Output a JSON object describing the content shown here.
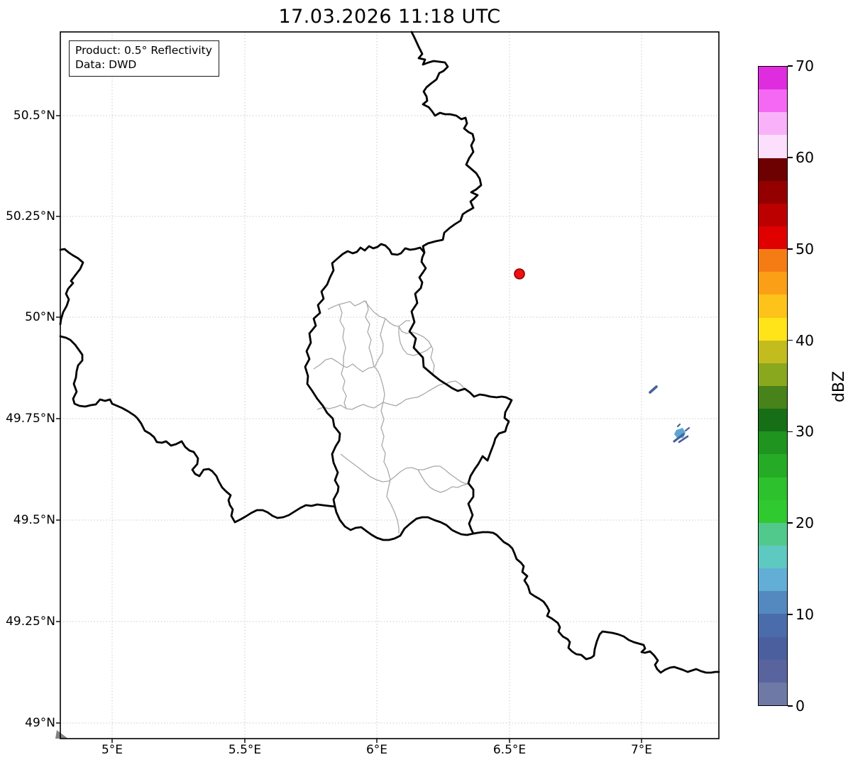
{
  "title": "17.03.2026 11:18 UTC",
  "info_box": {
    "product_line": "Product: 0.5° Reflectivity",
    "data_line": "Data: DWD"
  },
  "axes": {
    "x_ticks": [
      "5°E",
      "5.5°E",
      "6°E",
      "6.5°E",
      "7°E"
    ],
    "y_ticks": [
      "50.5°N",
      "50.25°N",
      "50°N",
      "49.75°N",
      "49.5°N",
      "49.25°N",
      "49°N"
    ]
  },
  "colorbar": {
    "label": "dBZ",
    "tick_values": [
      0,
      10,
      20,
      30,
      40,
      50,
      60,
      70
    ],
    "value_min": 0,
    "value_max": 70,
    "segment_step_dbz": 2.5,
    "segments_bottom_to_top": [
      "#6e79a5",
      "#59649f",
      "#4b5f9f",
      "#4a6cab",
      "#5389bf",
      "#62aed6",
      "#5ec9c0",
      "#52c98c",
      "#30c930",
      "#2dc22d",
      "#26ab26",
      "#1f941f",
      "#166f16",
      "#47821b",
      "#8aa81e",
      "#c3bc1e",
      "#ffe419",
      "#fdc31a",
      "#fb9f16",
      "#f57c14",
      "#e00000",
      "#bc0000",
      "#940000",
      "#6d0000",
      "#fcdffc",
      "#f9b2f9",
      "#f468f4",
      "#df2cdf"
    ]
  },
  "map": {
    "radar_site_marker": {
      "shape": "circle",
      "color": "#f01010",
      "edge_color": "#8c0000"
    },
    "echo_colors": {
      "weak": "#46619d",
      "moderate": "#5ba7d1"
    },
    "border_colors": {
      "country": "#000000",
      "district": "#a9a9a9"
    },
    "gridline_color": "#c9c9c9"
  }
}
